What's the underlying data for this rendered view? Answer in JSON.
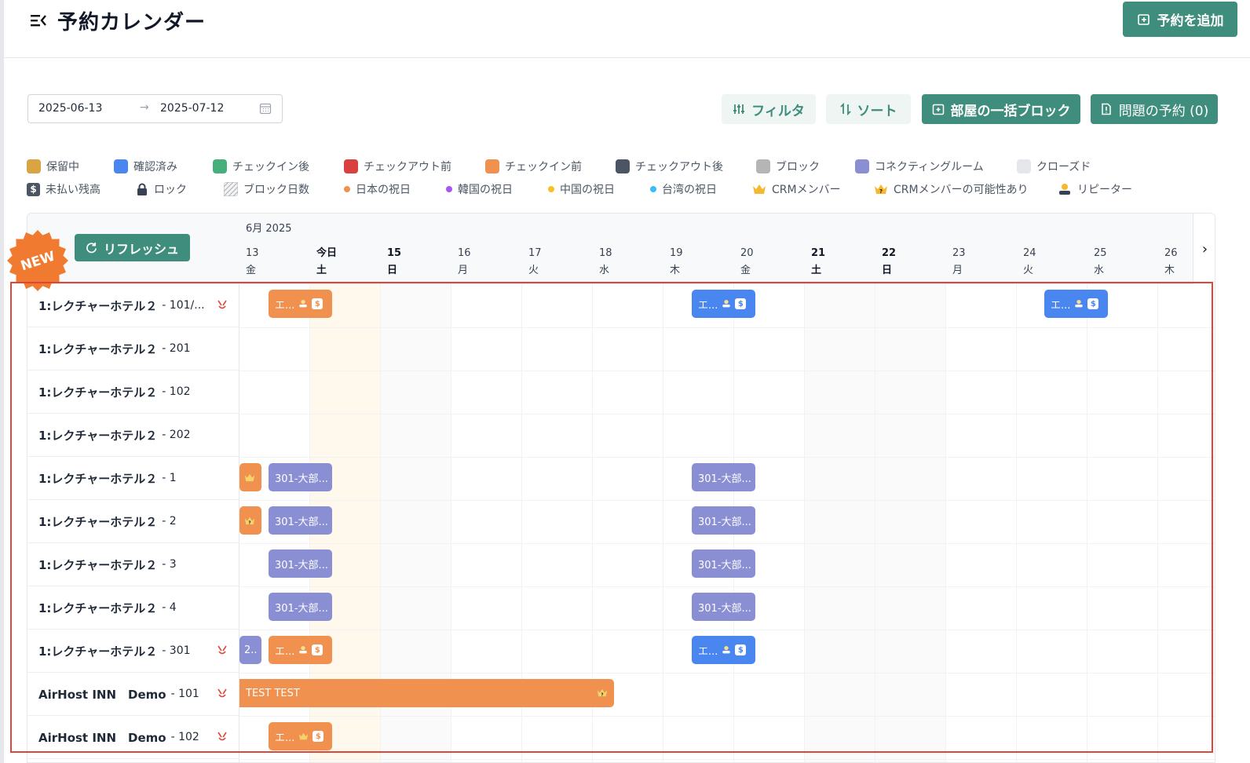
{
  "header": {
    "title": "予約カレンダー",
    "add_label": "予約を追加"
  },
  "toolbar": {
    "date_from": "2025-06-13",
    "date_arrow": "→",
    "date_to": "2025-07-12",
    "filter_label": "フィルタ",
    "sort_label": "ソート",
    "bulk_block_label": "部屋の一括ブロック",
    "issue_label": "問題の予約 (0)"
  },
  "legend": {
    "row1": [
      {
        "label": "保留中",
        "color": "#d9a441"
      },
      {
        "label": "確認済み",
        "color": "#4a86f0"
      },
      {
        "label": "チェックイン後",
        "color": "#45b07c"
      },
      {
        "label": "チェックアウト前",
        "color": "#d9413f"
      },
      {
        "label": "チェックイン前",
        "color": "#f0914f"
      },
      {
        "label": "チェックアウト後",
        "color": "#4b5563"
      },
      {
        "label": "ブロック",
        "color": "#b5b5b5"
      },
      {
        "label": "コネクティングルーム",
        "color": "#8a8fd4"
      },
      {
        "label": "クローズド",
        "color": "#e5e7eb"
      }
    ],
    "row2": [
      {
        "label": "未払い残高",
        "icon": "dollar-icon"
      },
      {
        "label": "ロック",
        "icon": "lock-icon"
      },
      {
        "label": "ブロック日数",
        "icon": "hatch-icon"
      },
      {
        "label": "日本の祝日",
        "color": "#f0914f"
      },
      {
        "label": "韓国の祝日",
        "color": "#a855f7"
      },
      {
        "label": "中国の祝日",
        "color": "#fbbf24"
      },
      {
        "label": "台湾の祝日",
        "color": "#38bdf8"
      },
      {
        "label": "CRMメンバー",
        "icon": "crown-icon"
      },
      {
        "label": "CRMメンバーの可能性あり",
        "icon": "crown-question-icon"
      },
      {
        "label": "リピーター",
        "icon": "repeater-icon"
      }
    ]
  },
  "calendar": {
    "refresh_label": "リフレッシュ",
    "new_badge": "NEW",
    "month": "6月 2025",
    "days": [
      {
        "num": "13",
        "dow": "金",
        "bold": false
      },
      {
        "num": "今日",
        "dow": "土",
        "bold": true
      },
      {
        "num": "15",
        "dow": "日",
        "bold": true
      },
      {
        "num": "16",
        "dow": "月",
        "bold": false
      },
      {
        "num": "17",
        "dow": "火",
        "bold": false
      },
      {
        "num": "18",
        "dow": "水",
        "bold": false
      },
      {
        "num": "19",
        "dow": "木",
        "bold": false
      },
      {
        "num": "20",
        "dow": "金",
        "bold": false
      },
      {
        "num": "21",
        "dow": "土",
        "bold": true
      },
      {
        "num": "22",
        "dow": "日",
        "bold": true
      },
      {
        "num": "23",
        "dow": "月",
        "bold": false
      },
      {
        "num": "24",
        "dow": "火",
        "bold": false
      },
      {
        "num": "25",
        "dow": "水",
        "bold": false
      },
      {
        "num": "26",
        "dow": "木",
        "bold": false
      }
    ],
    "rooms": [
      {
        "name": "1:レクチャーホテル２",
        "suffix": "- 101/...",
        "tool": true
      },
      {
        "name": "1:レクチャーホテル２",
        "suffix": "- 201",
        "tool": false
      },
      {
        "name": "1:レクチャーホテル２",
        "suffix": "- 102",
        "tool": false
      },
      {
        "name": "1:レクチャーホテル２",
        "suffix": "- 202",
        "tool": false
      },
      {
        "name": "1:レクチャーホテル２",
        "suffix": "- 1",
        "tool": false
      },
      {
        "name": "1:レクチャーホテル２",
        "suffix": "- 2",
        "tool": false
      },
      {
        "name": "1:レクチャーホテル２",
        "suffix": "- 3",
        "tool": false
      },
      {
        "name": "1:レクチャーホテル２",
        "suffix": "- 4",
        "tool": false
      },
      {
        "name": "1:レクチャーホテル２",
        "suffix": "- 301",
        "tool": true
      },
      {
        "name": "AirHost INN　Demo",
        "suffix": "- 101",
        "tool": true
      },
      {
        "name": "AirHost INN　Demo",
        "suffix": "- 102",
        "tool": true
      }
    ],
    "bookings": {
      "guest_short": "エ...",
      "connect_short": "301-大部...",
      "short2": "2..",
      "test": "TEST TEST"
    }
  }
}
